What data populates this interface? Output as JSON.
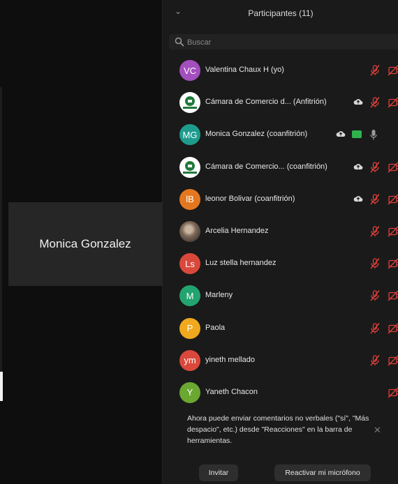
{
  "colors": {
    "mute_red": "#e0403a",
    "video_green": "#2fb34f",
    "panel_bg": "#1a1a1a",
    "video_bg": "#0e0e0e"
  },
  "video_tile": {
    "name": "Monica Gonzalez"
  },
  "panel": {
    "title": "Participantes (11)",
    "collapse_icon": "chevron-down-icon",
    "search_placeholder": "Buscar",
    "search_value": ""
  },
  "participants": [
    {
      "initials": "VC",
      "avatar_color": "#a34fbd",
      "avatar_type": "initials",
      "name": "Valentina Chaux H (yo)",
      "cloud": false,
      "video_on": false,
      "muted": true
    },
    {
      "initials": "",
      "avatar_color": "#ffffff",
      "avatar_type": "logo",
      "name": "Cámara de Comercio d...  (Anfitrión)",
      "cloud": true,
      "video_on": false,
      "muted": true
    },
    {
      "initials": "MG",
      "avatar_color": "#1e9c8e",
      "avatar_type": "initials",
      "name": "Monica Gonzalez (coanfitrión)",
      "cloud": true,
      "video_on": true,
      "muted": false
    },
    {
      "initials": "",
      "avatar_color": "#ffffff",
      "avatar_type": "logo",
      "name": "Cámara de Comercio...  (coanfitrión)",
      "cloud": true,
      "video_on": false,
      "muted": true
    },
    {
      "initials": "lB",
      "avatar_color": "#e3771f",
      "avatar_type": "initials",
      "name": "leonor Bolivar (coanfitrión)",
      "cloud": true,
      "video_on": false,
      "muted": true
    },
    {
      "initials": "",
      "avatar_color": "#8a7060",
      "avatar_type": "photo",
      "name": "Arcelia Hernandez",
      "cloud": false,
      "video_on": false,
      "muted": true
    },
    {
      "initials": "Ls",
      "avatar_color": "#d9483b",
      "avatar_type": "initials",
      "name": "Luz stella hernandez",
      "cloud": false,
      "video_on": false,
      "muted": true
    },
    {
      "initials": "M",
      "avatar_color": "#23a36f",
      "avatar_type": "initials",
      "name": "Marleny",
      "cloud": false,
      "video_on": false,
      "muted": true
    },
    {
      "initials": "P",
      "avatar_color": "#f0a81e",
      "avatar_type": "initials",
      "name": "Paola",
      "cloud": false,
      "video_on": false,
      "muted": true
    },
    {
      "initials": "ym",
      "avatar_color": "#d9483b",
      "avatar_type": "initials",
      "name": "yineth mellado",
      "cloud": false,
      "video_on": false,
      "muted": true
    },
    {
      "initials": "Y",
      "avatar_color": "#6aa832",
      "avatar_type": "initials",
      "name": "Yaneth Chacon",
      "cloud": false,
      "video_on": false,
      "muted": null
    }
  ],
  "notice": {
    "text": "Ahora puede enviar comentarios no verbales (\"sí\", \"Más despacio\", etc.) desde \"Reacciones\" en la barra de herramientas.",
    "close_icon": "close-icon"
  },
  "buttons": {
    "invite": "Invitar",
    "unmute": "Reactivar mi micrófono"
  }
}
